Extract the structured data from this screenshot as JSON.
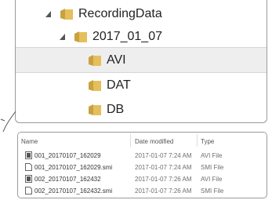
{
  "tree": {
    "items": [
      {
        "label": "RecordingData",
        "expanded": true,
        "level": 0
      },
      {
        "label": "2017_01_07",
        "expanded": true,
        "level": 1
      },
      {
        "label": "AVI",
        "selected": true,
        "level": 2
      },
      {
        "label": "DAT",
        "level": 2
      },
      {
        "label": "DB",
        "level": 2
      }
    ]
  },
  "file_list": {
    "columns": {
      "name": "Name",
      "date": "Date modified",
      "type": "Type"
    },
    "rows": [
      {
        "name": "001_20170107_162029",
        "date": "2017-01-07  7:24 AM",
        "type": "AVI File",
        "icon": "video-file-icon"
      },
      {
        "name": "001_20170107_162029.smi",
        "date": "2017-01-07  7:24 AM",
        "type": "SMI File",
        "icon": "text-file-icon"
      },
      {
        "name": "002_20170107_162432",
        "date": "2017-01-07  7:26 AM",
        "type": "AVI File",
        "icon": "video-file-icon"
      },
      {
        "name": "002_20170107_162432.smi",
        "date": "2017-01-07  7:26 AM",
        "type": "SMI File",
        "icon": "text-file-icon"
      }
    ]
  },
  "colors": {
    "folder": "#e4bf5c",
    "selection": "#eeeeee",
    "border": "#9a9a9a"
  }
}
